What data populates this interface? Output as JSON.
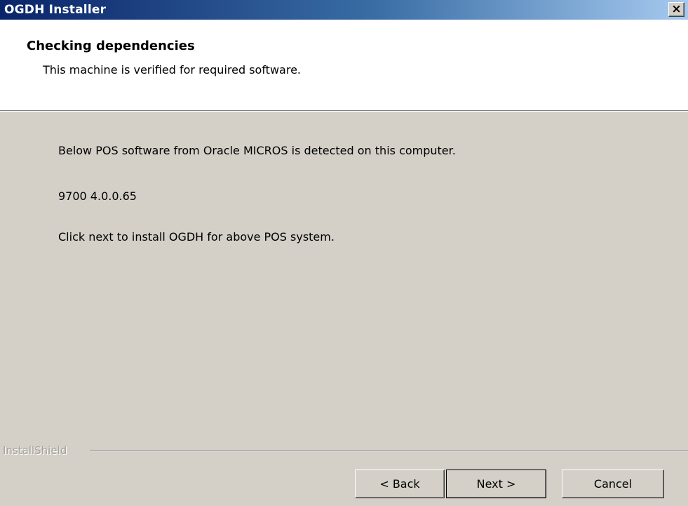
{
  "window": {
    "title": "OGDH Installer",
    "close_glyph": "×"
  },
  "header": {
    "title": "Checking dependencies",
    "subtitle": "This machine is verified for required software."
  },
  "body": {
    "line1": "Below POS software from Oracle MICROS is detected on this computer.",
    "line2": "9700 4.0.0.65",
    "line3": "Click next to install OGDH for above POS system."
  },
  "footer": {
    "brand": "InstallShield",
    "back_label": "< Back",
    "next_label": "Next >",
    "cancel_label": "Cancel"
  },
  "colors": {
    "titlebar_start": "#0a246a",
    "titlebar_end": "#a6caf0",
    "dialog_bg": "#d4d0c8",
    "header_bg": "#ffffff"
  }
}
